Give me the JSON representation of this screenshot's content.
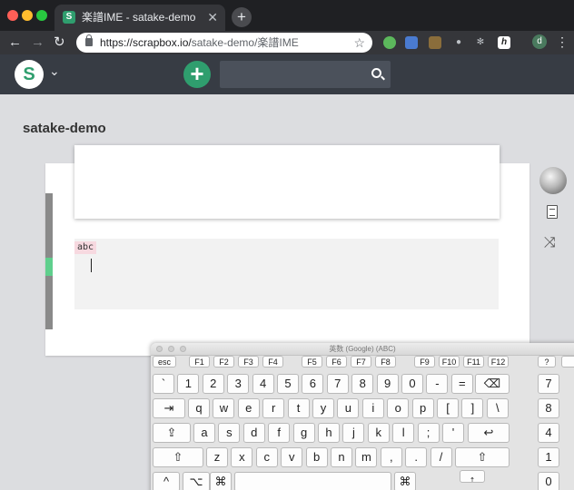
{
  "browser": {
    "tab_title": "楽譜IME - satake-demo",
    "tab_close": "✕",
    "new_tab": "+",
    "url_scheme": "https://scrapbox.io/",
    "url_path": "satake-demo/楽譜IME",
    "avatar_letter": "d"
  },
  "scrapbox": {
    "project_name": "satake-demo",
    "code_label": "abc",
    "accent_color": "#2f9e6e"
  },
  "keyboard_viewer": {
    "title": "英数 (Google) (ABC)",
    "fn_row": [
      "esc",
      "F1",
      "F2",
      "F3",
      "F4",
      "F5",
      "F6",
      "F7",
      "F8",
      "F9",
      "F10",
      "F11",
      "F12"
    ],
    "side_row1": [
      "?",
      "",
      ""
    ],
    "row1": [
      "`",
      "1",
      "2",
      "3",
      "4",
      "5",
      "6",
      "7",
      "8",
      "9",
      "0",
      "-",
      "=",
      "⌫",
      "⌦",
      "7"
    ],
    "row2": [
      "⇥",
      "q",
      "w",
      "e",
      "r",
      "t",
      "y",
      "u",
      "i",
      "o",
      "p",
      "[",
      "]",
      "\\",
      "8"
    ],
    "row3": [
      "⇪",
      "a",
      "s",
      "d",
      "f",
      "g",
      "h",
      "j",
      "k",
      "l",
      ";",
      "'",
      "↩",
      "4"
    ],
    "row4": [
      "⇧",
      "z",
      "x",
      "c",
      "v",
      "b",
      "n",
      "m",
      ",",
      ".",
      "/",
      "⇧",
      "1"
    ],
    "row5": [
      "^",
      "⌥",
      "⌘",
      "⌘",
      "↑",
      "0"
    ]
  }
}
